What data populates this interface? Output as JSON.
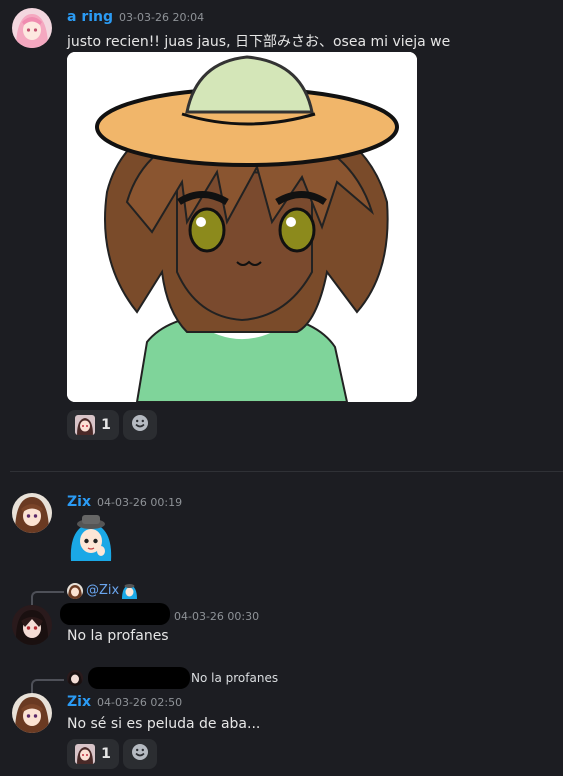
{
  "messages": [
    {
      "author": "a ring",
      "timestamp": "03-03-26 20:04",
      "text": "justo recien!! juas jaus, 日下部みさお、osea mi vieja we",
      "reactions": [
        {
          "icon": "anime-avatar-emoji",
          "count": "1"
        },
        {
          "icon": "add-reaction-icon"
        }
      ]
    },
    {
      "author": "Zix",
      "timestamp": "04-03-26 00:19",
      "sticker": "blue-hair-anime-sticker"
    },
    {
      "reply_to_mention": "@Zix",
      "timestamp": "04-03-26 00:30",
      "text": "No la profanes"
    },
    {
      "reply_to_text": "No la profanes",
      "author": "Zix",
      "timestamp": "04-03-26 02:50",
      "text": "No sé si es peluda de aba...",
      "reactions": [
        {
          "icon": "anime-avatar-emoji",
          "count": "1"
        },
        {
          "icon": "add-reaction-icon"
        }
      ]
    }
  ],
  "colors": {
    "background": "#1c1d22",
    "username": "#2b9bf4",
    "timestamp": "#8e9297"
  }
}
